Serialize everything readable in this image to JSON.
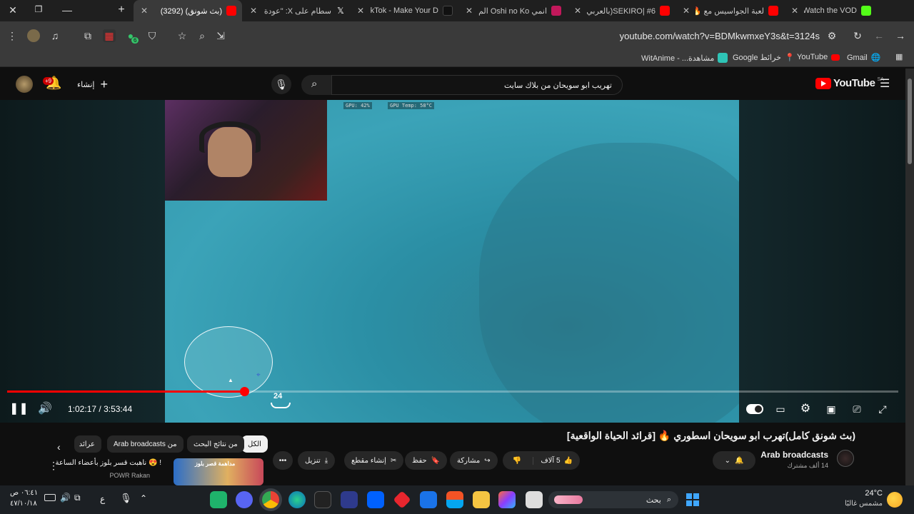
{
  "browser": {
    "tabs": [
      {
        "title": "(بث شونق) (3292)",
        "favicon_color": "#ff0000",
        "active": true
      },
      {
        "title": "سطام على X: \"عودة ح",
        "favicon_color": "#ffffff",
        "active": false
      },
      {
        "title": "TikTok - Make Your D",
        "favicon_color": "#111111",
        "active": false
      },
      {
        "title": "انمي Oshi no Ko الم",
        "favicon_color": "#c2185b",
        "active": false
      },
      {
        "title": "SEKIRO| #6(بالعربي)",
        "favicon_color": "#ff0000",
        "active": false
      },
      {
        "title": "لعبة الجواسيس مع 🔥",
        "favicon_color": "#ff0000",
        "active": false
      },
      {
        "title": "SXB - Watch the VOD",
        "favicon_color": "#53fc18",
        "active": false
      }
    ],
    "new_tab_symbol": "+",
    "url": "youtube.com/watch?v=BDMkwmxeY3s&t=3124s",
    "extension_badge": "6",
    "bookmarks": [
      {
        "label": "Gmail"
      },
      {
        "label": "YouTube"
      },
      {
        "label": "خرائط Google"
      },
      {
        "label": "مشاهدة... - WitAnime"
      }
    ]
  },
  "youtube": {
    "logo_text": "YouTube",
    "region": "SA",
    "search_query": "تهريب ابو سويحان من بلاك سايت",
    "create_label": "إنشاء",
    "notif_badge": "+9",
    "stats_overlay": [
      "GPU: 42%",
      "GPU Temp: 58°C"
    ],
    "player": {
      "time_current": "1:02:17",
      "time_sep": "/",
      "time_total": "3:53:44",
      "progress_fraction": 0.266,
      "hud_number": "24"
    },
    "video_title": "(بث شونق كامل)تهرب ابو سويحان اسطوري 🔥 [قرائد الحياة الواقعية]",
    "channel": {
      "name": "Arab broadcasts",
      "subs": "14 ألف مشترك"
    },
    "actions": {
      "likes": "5 آلاف",
      "share": "مشاركة",
      "save": "حفظ",
      "clip": "إنشاء مقطع",
      "download": "تنزيل",
      "more": "•••"
    },
    "chips": [
      {
        "label": "الكل",
        "active": true
      },
      {
        "label": "من نتائج البحث",
        "active": false
      },
      {
        "label": "من Arab broadcasts",
        "active": false
      },
      {
        "label": "عرائد",
        "active": false
      }
    ],
    "related": {
      "title": "! 😍 ناهبت قسر بلوز بأعضاء الساعة",
      "channel": "POWR Rakan",
      "thumb_text": "مداهمة قصر بلوز"
    }
  },
  "taskbar": {
    "weather_temp": "24°C",
    "weather_desc": "مشمس غالبًا",
    "search_placeholder": "بحث",
    "time": "٠٦:٤١ ص",
    "date": "٤٧/١٠/١٨",
    "lang": "ع"
  }
}
